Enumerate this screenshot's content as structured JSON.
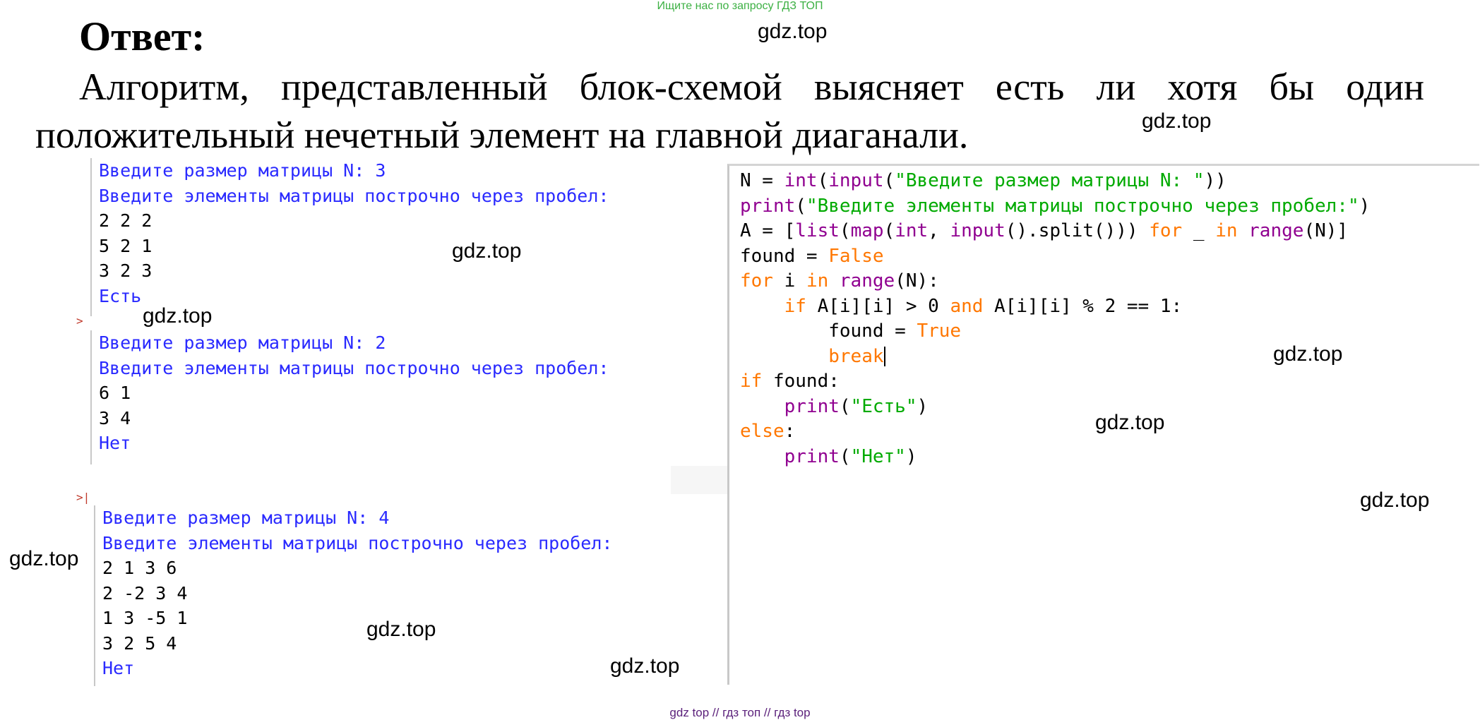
{
  "top_banner": "Ищите нас по запросу ГДЗ ТОП",
  "answer_title": "Ответ:",
  "paragraph": {
    "line1": "Алгоритм, представленный блок-схемой выясняет есть ли хотя бы один",
    "line2": "положительный нечетный элемент на главной диаганали."
  },
  "watermark": "gdz.top",
  "console_markers": {
    "run2": ">",
    "run3": ">|"
  },
  "console_run1": [
    "Введите размер матрицы N: 3",
    "Введите элементы матрицы построчно через пробел:",
    "2 2 2",
    "5 2 1",
    "3 2 3",
    "Есть"
  ],
  "console_run2": [
    "Введите размер матрицы N: 2",
    "Введите элементы матрицы построчно через пробел:",
    "6 1",
    "3 4",
    "Нет"
  ],
  "console_run3": [
    "Введите размер матрицы N: 4",
    "Введите элементы матрицы построчно через пробел:",
    "2 1 3 6",
    "2 -2 3 4",
    "1 3 -5 1",
    "3 2 5 4",
    "Нет"
  ],
  "code": {
    "l1": {
      "a": "N = ",
      "b": "int",
      "c": "(",
      "d": "input",
      "e": "(",
      "f": "\"Введите размер матрицы N: \"",
      "g": "))"
    },
    "l2": {
      "a": "print",
      "b": "(",
      "c": "\"Введите элементы матрицы построчно через пробел:\"",
      "d": ")"
    },
    "l3": {
      "a": "A = [",
      "b": "list",
      "c": "(",
      "d": "map",
      "e": "(",
      "f": "int",
      "g": ", ",
      "h": "input",
      "i": "().split())) ",
      "j": "for",
      "k": " _ ",
      "l": "in",
      "m": " ",
      "n": "range",
      "o": "(N)]"
    },
    "l4": {
      "a": "found = ",
      "b": "False"
    },
    "l5": {
      "a": "for",
      "b": " i ",
      "c": "in",
      "d": " ",
      "e": "range",
      "f": "(N):"
    },
    "l6": {
      "a": "    ",
      "b": "if",
      "c": " A[i][i] > 0 ",
      "d": "and",
      "e": " A[i][i] % 2 == 1:"
    },
    "l7": {
      "a": "        found = ",
      "b": "True"
    },
    "l8": {
      "a": "        ",
      "b": "break"
    },
    "l9": {
      "a": "if",
      "b": " found:"
    },
    "l10": {
      "a": "    ",
      "b": "print",
      "c": "(",
      "d": "\"Есть\"",
      "e": ")"
    },
    "l11": {
      "a": "else",
      "b": ":"
    },
    "l12": {
      "a": "    ",
      "b": "print",
      "c": "(",
      "d": "\"Нет\"",
      "e": ")"
    }
  },
  "footer": "gdz top  //  гдз топ  //  гдз top",
  "colors": {
    "prompt": "#2a2aff",
    "keyword": "#ff7700",
    "builtin": "#900090",
    "string": "#00aa00",
    "banner": "#3cb043",
    "footer": "#5a1f7a"
  }
}
